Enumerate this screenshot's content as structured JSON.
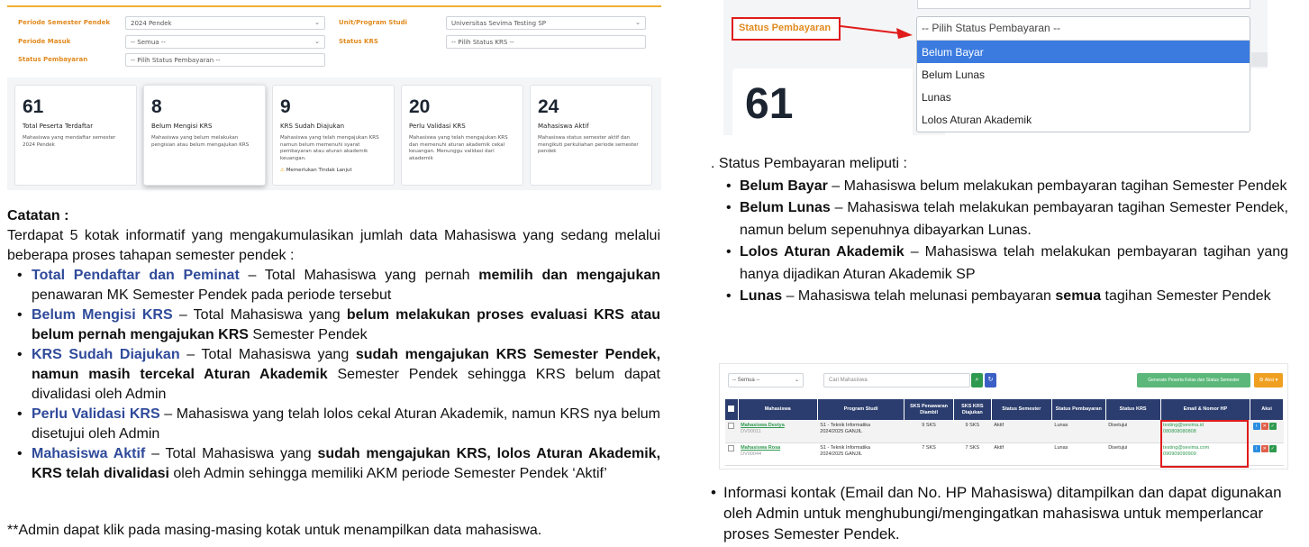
{
  "filters": {
    "periode_label": "Periode Semester Pendek",
    "periode_value": "2024 Pendek",
    "unit_label": "Unit/Program Studi",
    "unit_value": "Universitas Sevima Testing SP",
    "masuk_label": "Periode Masuk",
    "masuk_value": "-- Semua --",
    "krs_label": "Status KRS",
    "krs_placeholder": "-- Pilih Status KRS --",
    "bayar_label": "Status Pembayaran",
    "bayar_placeholder": "-- Pilih Status Pembayaran --"
  },
  "cards": [
    {
      "num": "61",
      "title": "Total Peserta Terdaftar",
      "desc": "Mahasiswa yang mendaftar semester 2024 Pendek"
    },
    {
      "num": "8",
      "title": "Belum Mengisi KRS",
      "desc": "Mahasiswa yang belum melakukan pengisian atau belum mengajukan KRS"
    },
    {
      "num": "9",
      "title": "KRS Sudah Diajukan",
      "desc": "Mahasiswa yang telah mengajukan KRS namun belum memenuhi syarat pembayaran atau aturan akademik keuangan.",
      "warn": "Memerlukan Tindak Lanjut"
    },
    {
      "num": "20",
      "title": "Perlu Validasi KRS",
      "desc": "Mahasiswa yang telah mengajukan KRS dan memenuhi aturan akademik cekal keuangan. Menunggu validasi dari akademik"
    },
    {
      "num": "24",
      "title": "Mahasiswa Aktif",
      "desc": "Mahasiswa status semester aktif dan mengikuti perkuliahan periode semester pendek"
    }
  ],
  "left_text": {
    "catatan": "Catatan :",
    "intro": "Terdapat 5 kotak informatif yang mengakumulasikan jumlah data Mahasiswa yang sedang melalui beberapa proses tahapan semester pendek :",
    "items": [
      {
        "term": "Total Pendaftar dan Peminat",
        "p1": " – Total Mahasiswa yang pernah ",
        "b1": "memilih dan mengajukan",
        "p2": " penawaran MK Semester Pendek pada periode tersebut"
      },
      {
        "term": "Belum Mengisi KRS",
        "p1": " – Total Mahasiswa yang ",
        "b1": "belum melakukan proses evaluasi KRS atau belum pernah mengajukan KRS",
        "p2": " Semester Pendek"
      },
      {
        "term": "KRS Sudah Diajukan",
        "p1": " – Total Mahasiswa yang ",
        "b1": "sudah mengajukan KRS Semester Pendek, namun masih tercekal Aturan Akademik",
        "p2": " Semester Pendek sehingga KRS belum dapat divalidasi oleh Admin"
      },
      {
        "term": "Perlu Validasi KRS",
        "p1": " –  Mahasiswa yang telah lolos cekal Aturan Akademik, namun KRS nya belum disetujui oleh Admin",
        "b1": "",
        "p2": ""
      },
      {
        "term": "Mahasiswa Aktif",
        "p1": " – Total Mahasiswa yang ",
        "b1": "sudah mengajukan KRS, lolos Aturan Akademik, KRS telah divalidasi",
        "p2": " oleh Admin sehingga memiliki AKM periode Semester Pendek ‘Aktif’"
      }
    ],
    "footnote": "**Admin dapat klik pada masing-masing kotak untuk menampilkan data mahasiswa."
  },
  "dropdown": {
    "label": "Status Pembayaran",
    "placeholder": "-- Pilih Status Pembayaran --",
    "options": [
      "Belum Bayar",
      "Belum Lunas",
      "Lunas",
      "Lolos Aturan Akademik"
    ],
    "selected_index": 0,
    "card_number": "61"
  },
  "right_text": {
    "intro": ". Status Pembayaran meliputi :",
    "items": [
      {
        "term": "Belum Bayar",
        "p1": " – Mahasiswa belum melakukan pembayaran tagihan Semester Pendek",
        "b1": "",
        "p2": ""
      },
      {
        "term": "Belum Lunas",
        "p1": " – Mahasiswa telah melakukan pembayaran tagihan Semester Pendek, namun belum sepenuhnya dibayarkan Lunas.",
        "b1": "",
        "p2": ""
      },
      {
        "term": "Lolos Aturan Akademik",
        "p1": " – Mahasiswa telah melakukan pembayaran tagihan yang hanya dijadikan Aturan Akademik SP",
        "b1": "",
        "p2": ""
      },
      {
        "term": "Lunas",
        "p1": " – Mahasiswa telah melunasi pembayaran ",
        "b1": "semua",
        "p2": " tagihan Semester Pendek"
      }
    ]
  },
  "table": {
    "filter_value": "-- Semua --",
    "search_placeholder": "Cari Mahasiswa",
    "generate_label": "Generate Peserta Kelas dan Status Semester",
    "aksi_label": "Aksi",
    "headers": [
      "Mahasiswa",
      "Program Studi",
      "SKS Penawaran Diambil",
      "SKS KRS Diajukan",
      "Status Semester",
      "Status Pembayaran",
      "Status KRS",
      "Email & Nomor HP",
      "Aksi"
    ],
    "rows": [
      {
        "nama": "Mahasiswa Destya",
        "nim": "DV00011",
        "prodi": "S1 - Teknik Informatika",
        "periode": "2024/2025 GANJIL",
        "sks_ambil": "9 SKS",
        "sks_krs": "9 SKS",
        "status_semester": "Aktif",
        "bayar": "Lunas",
        "krs": "Disetujui",
        "email": "testing@sevima.id",
        "hp": "080808080808"
      },
      {
        "nama": "Mahasiswa Rosa",
        "nim": "DV00044",
        "prodi": "S1 - Teknik Informatika",
        "periode": "2024/2025 GANJIL",
        "sks_ambil": "7 SKS",
        "sks_krs": "7 SKS",
        "status_semester": "Aktif",
        "bayar": "Lunas",
        "krs": "Disetujui",
        "email": "testing@sevima.com",
        "hp": "090909090909"
      }
    ]
  },
  "bottom_note": "Informasi kontak (Email dan No. HP Mahasiswa) ditampilkan dan dapat digunakan oleh Admin untuk menghubungi/mengingatkan mahasiswa untuk memperlancar proses Semester Pendek.",
  "colors": {
    "accent_orange": "#e08a1e",
    "highlight_red": "#e01b1b",
    "term_blue": "#2f4a9a",
    "table_header": "#2b3d6e",
    "selected_option": "#3b7be0"
  }
}
